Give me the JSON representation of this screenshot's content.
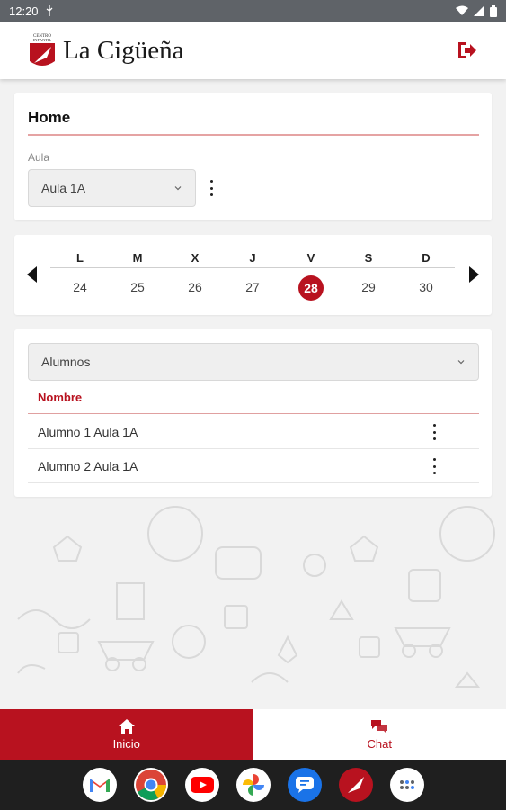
{
  "status_bar": {
    "time": "12:20",
    "icons": [
      "usb-icon",
      "wifi-icon",
      "signal-icon",
      "battery-icon"
    ]
  },
  "app_bar": {
    "logo_small_text": "CENTRO INFANTIL",
    "title": "La Cigüeña",
    "logout_icon": "logout-icon"
  },
  "home": {
    "title": "Home",
    "aula_label": "Aula",
    "aula_value": "Aula 1A"
  },
  "calendar": {
    "day_names": [
      "L",
      "M",
      "X",
      "J",
      "V",
      "S",
      "D"
    ],
    "day_numbers": [
      "24",
      "25",
      "26",
      "27",
      "28",
      "29",
      "30"
    ],
    "selected_day": "28"
  },
  "students": {
    "select_value": "Alumnos",
    "column_header": "Nombre",
    "rows": [
      "Alumno 1 Aula 1A",
      "Alumno 2 Aula 1A"
    ]
  },
  "bottom_nav": {
    "tabs": [
      {
        "label": "Inicio",
        "icon": "home-icon",
        "active": true
      },
      {
        "label": "Chat",
        "icon": "chat-icon",
        "active": false
      }
    ]
  },
  "system_nav": {
    "apps": [
      "gmail-icon",
      "chrome-icon",
      "youtube-icon",
      "photos-icon",
      "messages-icon",
      "la-ciguena-app-icon",
      "app-drawer-icon"
    ]
  },
  "colors": {
    "accent": "#b8121f",
    "status_bar": "#5f6368",
    "nav_bar": "#1f1f1f"
  }
}
